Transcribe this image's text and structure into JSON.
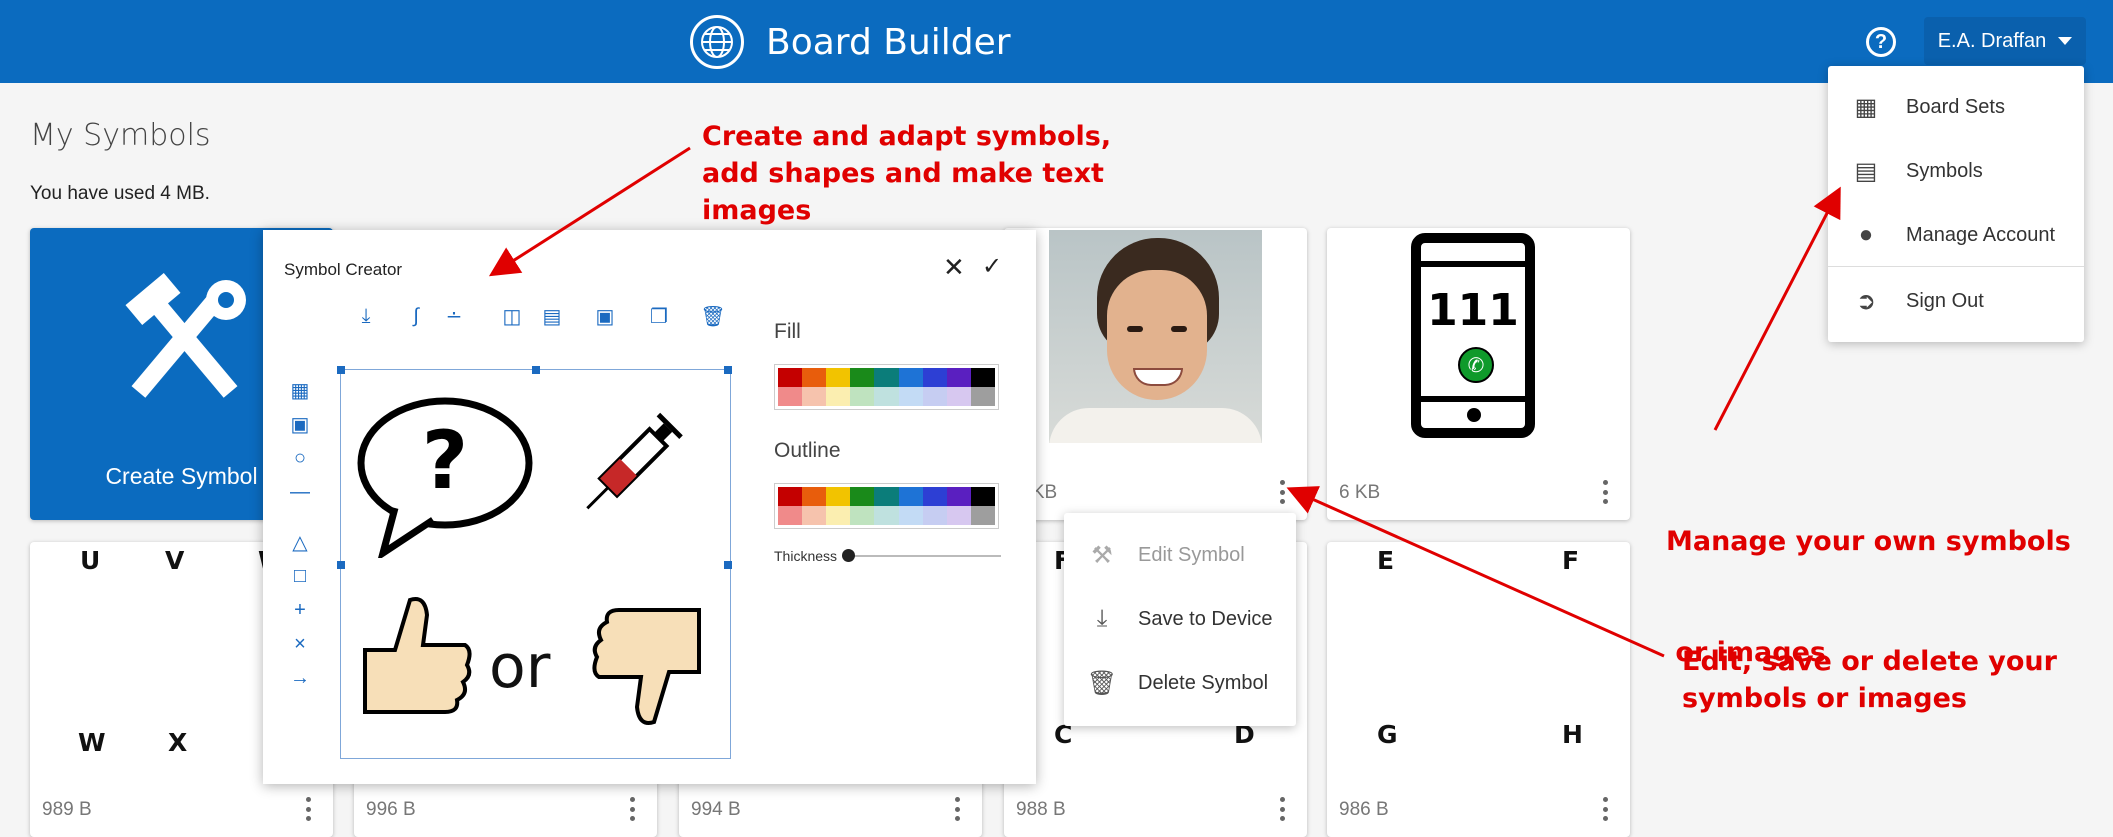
{
  "header": {
    "title": "Board Builder",
    "help_label": "?",
    "user_label": "E.A. Draffan"
  },
  "page": {
    "title": "My Symbols",
    "usage": "You have used 4 MB."
  },
  "user_menu": {
    "items": [
      {
        "label": "Board Sets",
        "icon": "grid-icon"
      },
      {
        "label": "Symbols",
        "icon": "photo-library-icon"
      },
      {
        "label": "Manage Account",
        "icon": "person-icon"
      },
      {
        "label": "Sign Out",
        "icon": "exit-icon"
      }
    ]
  },
  "cards": {
    "create_label": "Create Symbol",
    "row1": [
      {
        "size": "4 KB"
      },
      {
        "size": "6 KB",
        "phone_number": "111"
      }
    ],
    "row2": [
      {
        "size": "989 B",
        "letters": [
          "U",
          "V",
          "W",
          "W",
          "X"
        ]
      },
      {
        "size": "996 B"
      },
      {
        "size": "994 B"
      },
      {
        "size": "988 B",
        "letters": [
          "F",
          "C",
          "D"
        ]
      },
      {
        "size": "986 B",
        "letters": [
          "E",
          "F",
          "G",
          "H"
        ]
      }
    ]
  },
  "context_menu": {
    "items": [
      {
        "label": "Edit Symbol",
        "icon": "tools-icon",
        "disabled": true
      },
      {
        "label": "Save to Device",
        "icon": "download-icon",
        "disabled": false
      },
      {
        "label": "Delete Symbol",
        "icon": "trash-icon",
        "disabled": false
      }
    ]
  },
  "symbol_creator": {
    "title": "Symbol Creator",
    "fill_label": "Fill",
    "outline_label": "Outline",
    "thickness_label": "Thickness",
    "canvas_text": "or",
    "palette_top": [
      "#c40000",
      "#e85d0c",
      "#f2c300",
      "#1a8a1a",
      "#0b7d7a",
      "#1e73d6",
      "#2d3fd4",
      "#5a1fc0",
      "#000000"
    ],
    "palette_bottom": [
      "#f08a8a",
      "#f6c3ad",
      "#fbeeb0",
      "#bfe3bf",
      "#bfe1df",
      "#c3dbf5",
      "#c6cdf2",
      "#d7c8f0",
      "#9e9e9e"
    ]
  },
  "annotations": {
    "create": [
      "Create and adapt symbols,",
      "add shapes and make text",
      "images"
    ],
    "manage": [
      "Manage your own symbols",
      " or images"
    ],
    "edit": [
      "Edit, save or delete your",
      "symbols or images"
    ]
  },
  "colors": {
    "brand": "#0b6bbf",
    "annotation": "#e00000"
  }
}
